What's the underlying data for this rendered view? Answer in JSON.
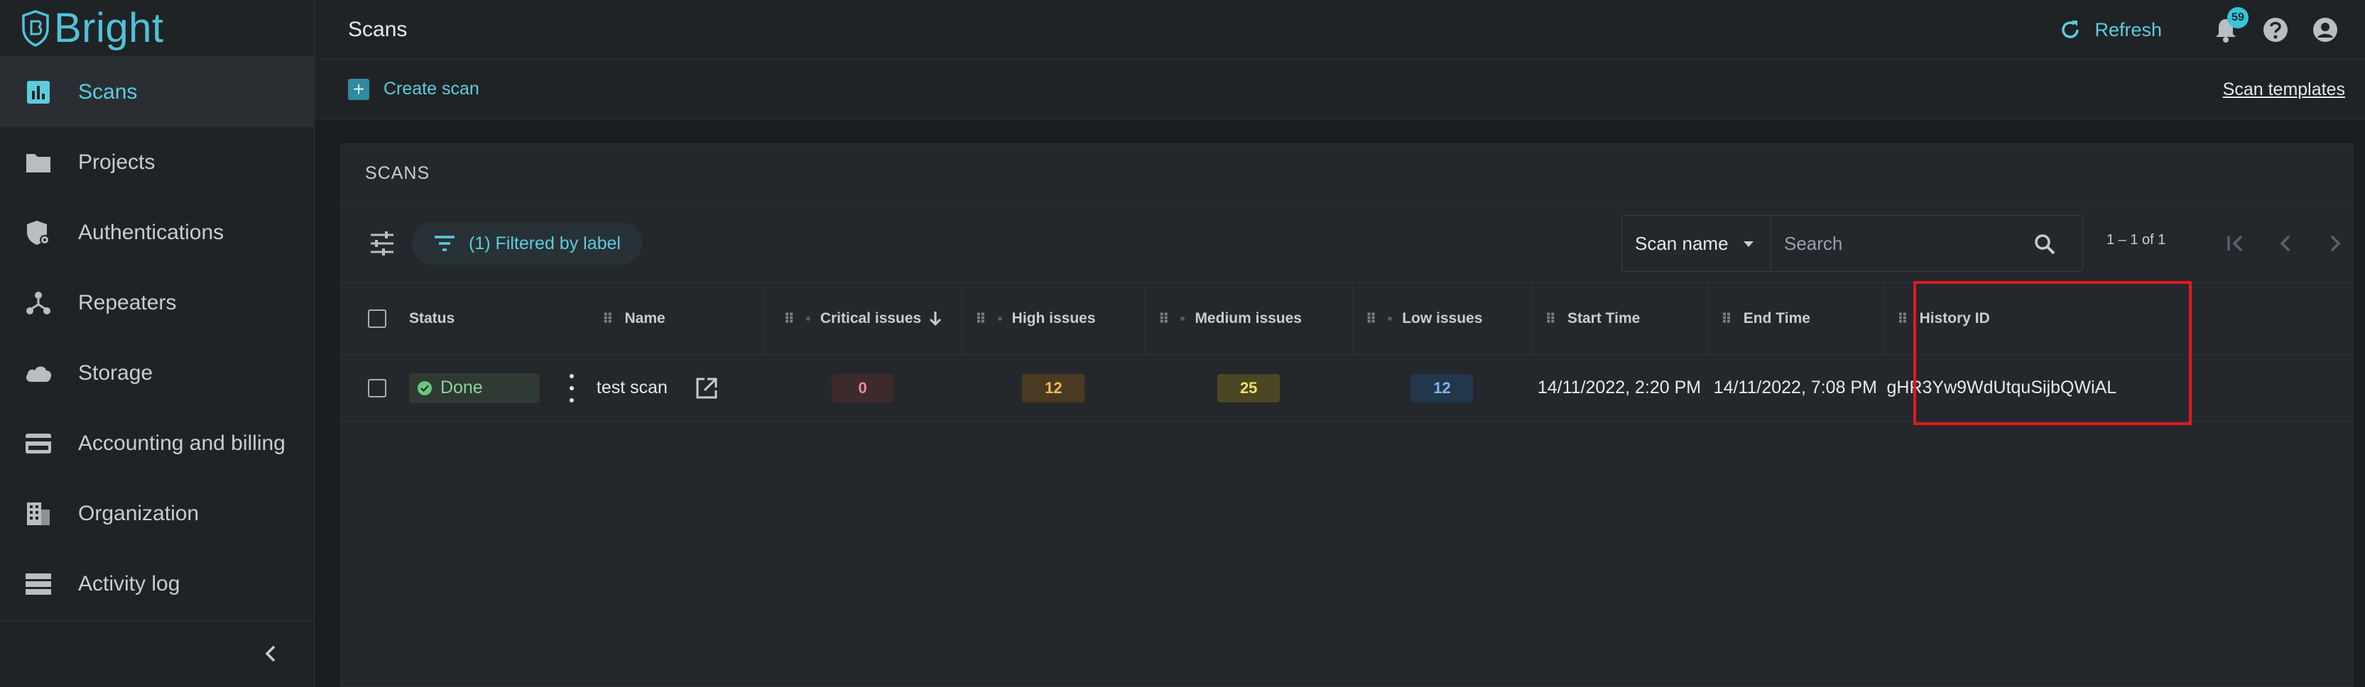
{
  "app": {
    "brand": "Bright"
  },
  "sidebar": {
    "items": [
      {
        "label": "Scans",
        "icon": "bar-chart-icon",
        "active": true
      },
      {
        "label": "Projects",
        "icon": "folder-icon"
      },
      {
        "label": "Authentications",
        "icon": "shield-key-icon"
      },
      {
        "label": "Repeaters",
        "icon": "network-icon"
      },
      {
        "label": "Storage",
        "icon": "cloud-icon"
      },
      {
        "label": "Accounting and billing",
        "icon": "credit-card-icon"
      },
      {
        "label": "Organization",
        "icon": "building-icon"
      },
      {
        "label": "Activity log",
        "icon": "server-list-icon"
      }
    ]
  },
  "header": {
    "title": "Scans",
    "refresh_label": "Refresh",
    "notification_count": "59"
  },
  "actions": {
    "create_label": "Create scan",
    "templates_label": "Scan templates"
  },
  "panel": {
    "title": "SCANS",
    "filter_label": "(1) Filtered by label",
    "search_field": "Scan name",
    "search_placeholder": "Search",
    "pagination": "1 – 1 of 1"
  },
  "table": {
    "columns": {
      "status": "Status",
      "name": "Name",
      "critical": "Critical issues",
      "high": "High issues",
      "medium": "Medium issues",
      "low": "Low issues",
      "start": "Start Time",
      "end": "End Time",
      "history": "History ID"
    },
    "rows": [
      {
        "status": "Done",
        "name": "test scan",
        "critical": "0",
        "high": "12",
        "medium": "25",
        "low": "12",
        "start": "14/11/2022, 2:20 PM",
        "end": "14/11/2022, 7:08 PM",
        "history": "gHR3Yw9WdUtquSijbQWiAL"
      }
    ]
  },
  "colors": {
    "accent": "#5ccce0",
    "critical_bg": "#3d2a2c",
    "critical_fg": "#f08a8f",
    "high_bg": "#4a3a22",
    "high_fg": "#f3b955",
    "medium_bg": "#4a4722",
    "medium_fg": "#f1e06a",
    "low_bg": "#22364c",
    "low_fg": "#7fb6f0",
    "highlight": "#e3191b"
  }
}
